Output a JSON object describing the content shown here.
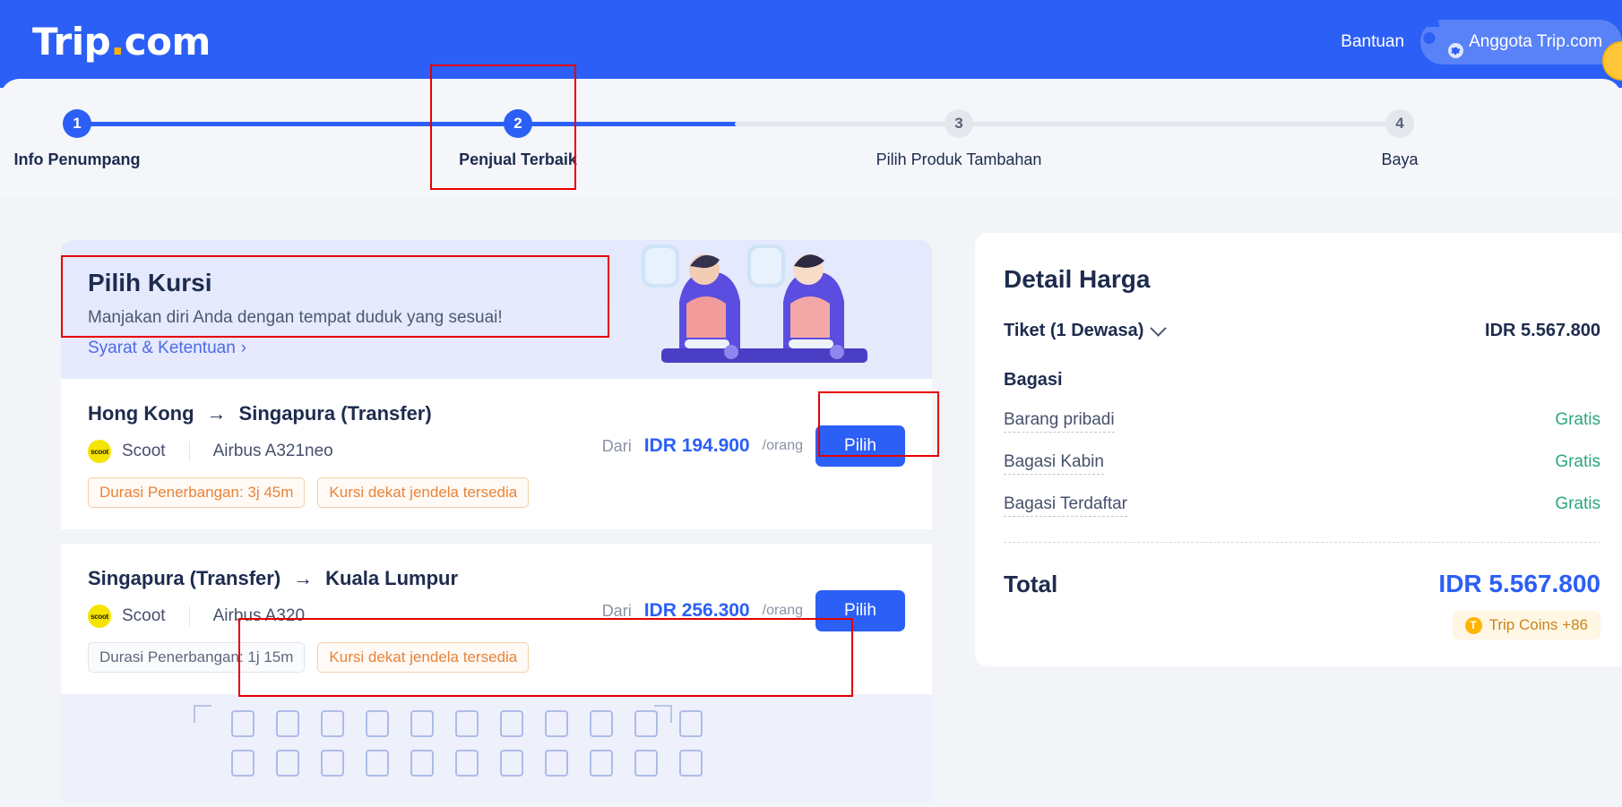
{
  "header": {
    "logo_text": "Trip",
    "logo_dot": ".",
    "logo_suffix": "com",
    "help_label": "Bantuan",
    "member_label": "Anggota Trip.com",
    "avatar_icon": "user-avatar-icon",
    "gear_icon": "gear-icon",
    "coin_icon": "coin-icon",
    "brand_color": "#2b5ff6",
    "accent_color": "#ffb400"
  },
  "stepper": {
    "steps": [
      {
        "number": "1",
        "label": "Info Penumpang",
        "state": "done"
      },
      {
        "number": "2",
        "label": "Penjual Terbaik",
        "state": "current"
      },
      {
        "number": "3",
        "label": "Pilih Produk Tambahan",
        "state": "todo"
      },
      {
        "number": "4",
        "label": "Baya",
        "state": "todo"
      }
    ]
  },
  "seat_banner": {
    "title": "Pilih Kursi",
    "subtitle": "Manjakan diri Anda dengan tempat duduk yang sesuai!",
    "terms_label": "Syarat & Ketentuan",
    "terms_chevron": "›",
    "illustration": "passengers-in-seats-illustration"
  },
  "flights": [
    {
      "origin": "Hong Kong",
      "arrow": "→",
      "destination": "Singapura (Transfer)",
      "airline": "Scoot",
      "airline_logo_text": "scoot",
      "aircraft": "Airbus A321neo",
      "tags": [
        {
          "text": "Durasi Penerbangan: 3j 45m",
          "style": "orange"
        },
        {
          "text": "Kursi dekat jendela tersedia",
          "style": "orange"
        }
      ],
      "price_prefix": "Dari",
      "price": "IDR 194.900",
      "price_suffix": "/orang",
      "select_label": "Pilih"
    },
    {
      "origin": "Singapura (Transfer)",
      "arrow": "→",
      "destination": "Kuala Lumpur",
      "airline": "Scoot",
      "airline_logo_text": "scoot",
      "aircraft": "Airbus A320",
      "tags": [
        {
          "text": "Durasi Penerbangan: 1j 15m",
          "style": "grey"
        },
        {
          "text": "Kursi dekat jendela tersedia",
          "style": "orange"
        }
      ],
      "price_prefix": "Dari",
      "price": "IDR 256.300",
      "price_suffix": "/orang",
      "select_label": "Pilih"
    }
  ],
  "seatmap": {
    "rows": 2,
    "columns": 11,
    "icon": "seat-grid-icon"
  },
  "price_panel": {
    "title": "Detail Harga",
    "ticket_label": "Tiket (1 Dewasa)",
    "ticket_value": "IDR 5.567.800",
    "baggage_title": "Bagasi",
    "baggage_items": [
      {
        "name": "Barang pribadi",
        "value": "Gratis"
      },
      {
        "name": "Bagasi Kabin",
        "value": "Gratis"
      },
      {
        "name": "Bagasi Terdaftar",
        "value": "Gratis"
      }
    ],
    "total_label": "Total",
    "total_value": "IDR 5.567.800",
    "coins_label": "Trip Coins +86",
    "coins_icon_letter": "T"
  },
  "annotations": {
    "color": "#e60000",
    "boxes": [
      "step-2-highlight",
      "pilih-kursi-highlight",
      "pilih-button-highlight",
      "seatmap-highlight"
    ]
  }
}
